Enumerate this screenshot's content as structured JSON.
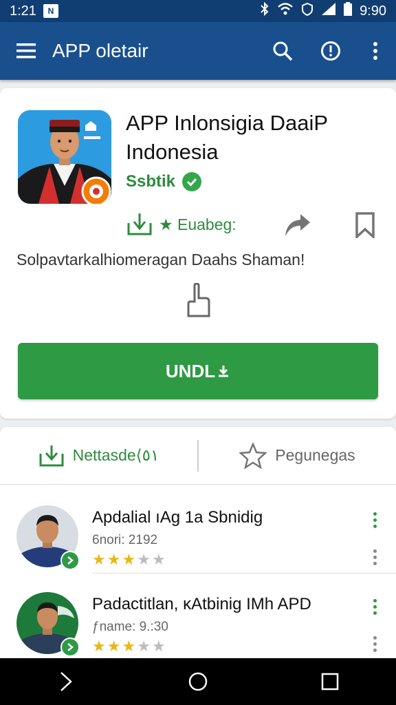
{
  "status_bar": {
    "time_left": "1:21",
    "time_right": "9:90",
    "notif_icon": "N"
  },
  "app_bar": {
    "title": "APP oletair"
  },
  "app": {
    "name": "APP Inlonsigia DaaiP Indonesia",
    "developer": "Ssbtik",
    "editors_badge": "★ Euabeg:",
    "description": "Solpavtarkalhiomeragan Daahs Shaman!",
    "install_label": "UNDL"
  },
  "tabs": {
    "installed_label": "Nettasde⟨٥١",
    "reviews_label": "Pegunegas"
  },
  "reviews": [
    {
      "name": "Apdalial ıAg 1a Sbnidig",
      "meta": "6nori: 2192",
      "rating": 3
    },
    {
      "name": "Padactitlan, κAtbinig IMh APD",
      "meta": "ƒname: 9.:30",
      "rating": 3
    }
  ],
  "colors": {
    "status_bar": "#103e72",
    "app_bar": "#1a4f8e",
    "accent_green": "#2e9a44",
    "star": "#e8b714"
  }
}
